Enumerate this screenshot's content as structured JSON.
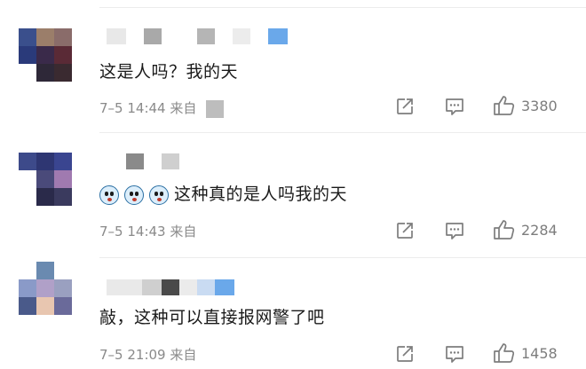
{
  "comments": [
    {
      "text": "这是人吗？我的天",
      "emoji_icons": [],
      "time": "7–5 14:44",
      "source_prefix": "来自",
      "like_count": "3380",
      "share_icon": "share-icon",
      "reply_icon": "reply-icon",
      "like_icon": "thumbs-up-icon"
    },
    {
      "text": "这种真的是人吗我的天",
      "emoji_icons": [
        "shocked-face-icon",
        "shocked-face-icon",
        "shocked-face-icon"
      ],
      "time": "7–5 14:43",
      "source_prefix": "来自",
      "like_count": "2284",
      "share_icon": "share-icon",
      "reply_icon": "reply-icon",
      "like_icon": "thumbs-up-icon"
    },
    {
      "text": "敲，这种可以直接报网警了吧",
      "emoji_icons": [],
      "time": "7–5 21:09",
      "source_prefix": "来自",
      "like_count": "1458",
      "share_icon": "share-icon",
      "reply_icon": "reply-icon",
      "like_icon": "thumbs-up-icon"
    }
  ],
  "colors": {
    "text": "#1a1a1a",
    "meta": "#8a8a8a",
    "icon": "#7d7d7d",
    "divider": "#ececec",
    "mosaic_name_accent": "#5aa0e8"
  }
}
